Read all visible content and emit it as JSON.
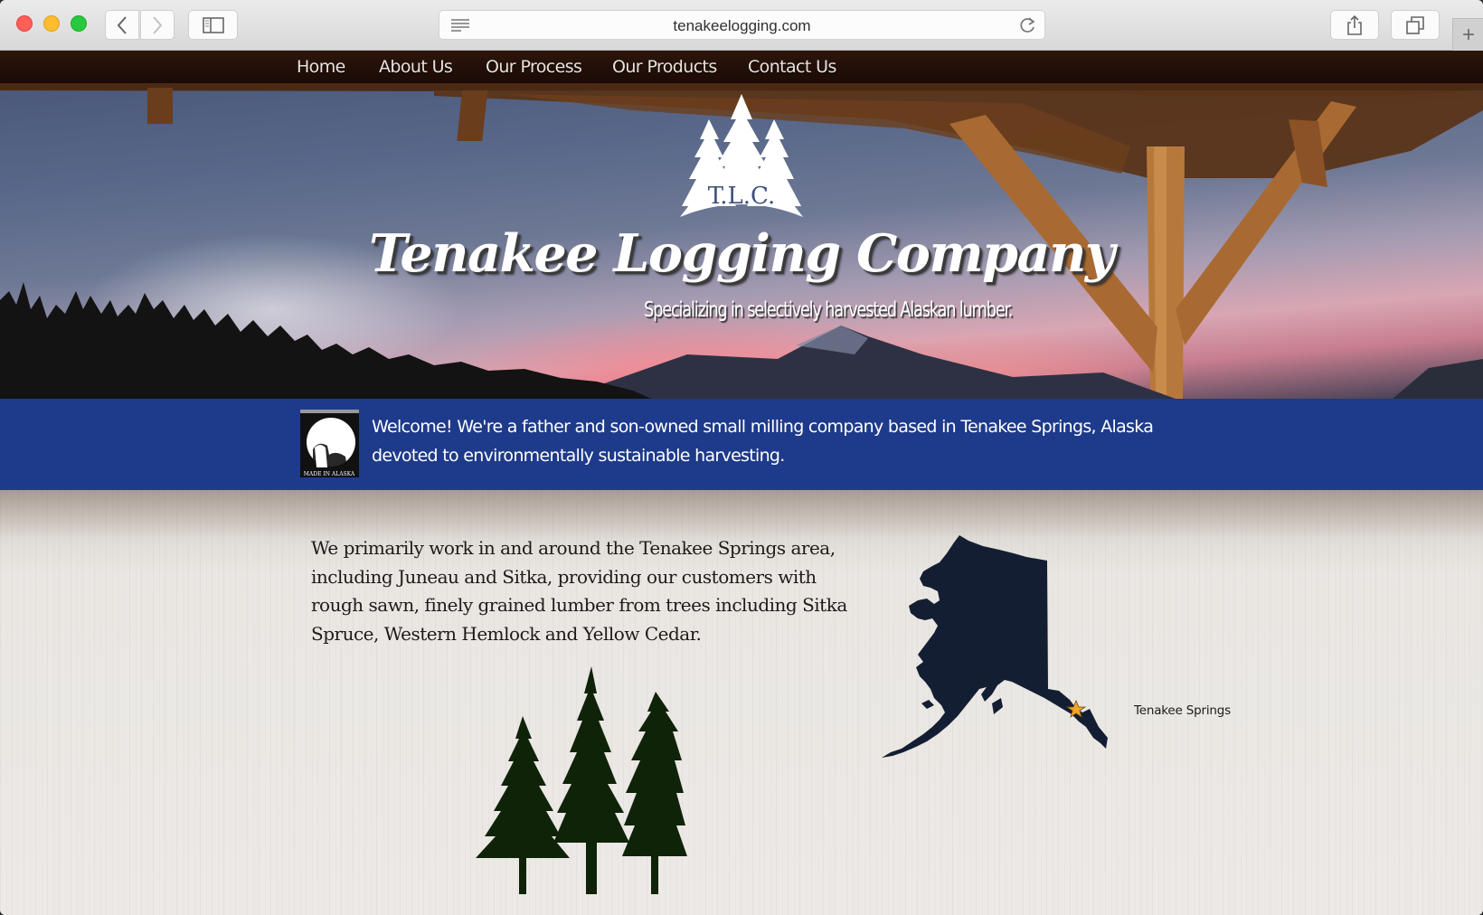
{
  "browser": {
    "url": "tenakeelogging.com",
    "buttons": {
      "back": "back",
      "forward": "forward",
      "sidebar": "show sidebar",
      "share": "share",
      "tabs": "show all tabs",
      "new_tab": "+"
    }
  },
  "nav": {
    "items": [
      {
        "label": "Home"
      },
      {
        "label": "About Us"
      },
      {
        "label": "Our Process"
      },
      {
        "label": "Our Products"
      },
      {
        "label": "Contact Us"
      }
    ]
  },
  "hero": {
    "logo_text": "T.L.C.",
    "title": "Tenakee Logging Company",
    "subtitle": "Specializing in selectively harvested Alaskan lumber."
  },
  "welcome": {
    "badge_text": "MADE IN ALASKA",
    "text": "Welcome! We're a father and son-owned small milling company based in Tenakee Springs, Alaska devoted to environmentally sustainable harvesting."
  },
  "content": {
    "paragraph": "We primarily work in and around the Tenakee Springs area, including Juneau and Sitka, providing our customers with rough sawn, finely grained lumber from trees including Sitka Spruce, Western Hemlock and Yellow Cedar.",
    "map_label": "Tenakee Springs"
  },
  "colors": {
    "nav_bg": "#2c150c",
    "band_bg": "#1e3a8a",
    "map_fill": "#141e33",
    "tree_fill": "#0f2308",
    "star": "#f4a52a"
  }
}
